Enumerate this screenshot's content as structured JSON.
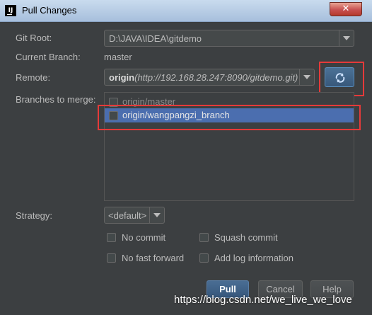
{
  "window": {
    "title": "Pull Changes",
    "app_icon_text": "IJ",
    "close_glyph": "✕"
  },
  "form": {
    "git_root_label": "Git Root:",
    "git_root_value": "D:\\JAVA\\IDEA\\gitdemo",
    "current_branch_label": "Current Branch:",
    "current_branch_value": "master",
    "remote_label": "Remote:",
    "remote_name": "origin",
    "remote_url": "(http://192.168.28.247:8090/gitdemo.git)",
    "branches_label": "Branches to merge:",
    "branches": [
      {
        "label": "origin/master",
        "checked": false,
        "selected": false
      },
      {
        "label": "origin/wangpangzi_branch",
        "checked": false,
        "selected": true
      }
    ],
    "strategy_label": "Strategy:",
    "strategy_value": "<default>"
  },
  "options": {
    "no_commit": "No commit",
    "squash_commit": "Squash commit",
    "no_fast_forward": "No fast forward",
    "add_log": "Add log information"
  },
  "buttons": {
    "pull": "Pull",
    "cancel": "Cancel",
    "help": "Help"
  },
  "icons": {
    "refresh": "refresh-icon",
    "dropdown": "chevron-down-icon"
  },
  "colors": {
    "background": "#3c3f41",
    "selection": "#4b6eaf",
    "highlight_box": "#e53a3a",
    "primary_button": "#4a6e94"
  },
  "watermark": "https://blog.csdn.net/we_live_we_love"
}
